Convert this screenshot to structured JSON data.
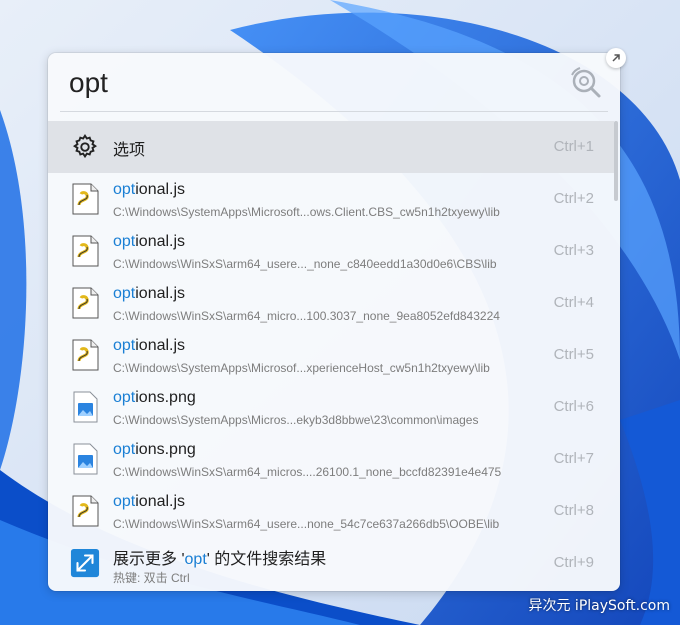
{
  "search": {
    "query": "opt"
  },
  "results": [
    {
      "icon": "gear-icon",
      "title_hl": "",
      "title_rest": "选项",
      "path": "",
      "shortcut": "Ctrl+1"
    },
    {
      "icon": "js-file-icon",
      "title_hl": "opt",
      "title_rest": "ional.js",
      "path": "C:\\Windows\\SystemApps\\Microsoft...ows.Client.CBS_cw5n1h2txyewy\\lib",
      "shortcut": "Ctrl+2"
    },
    {
      "icon": "js-file-icon",
      "title_hl": "opt",
      "title_rest": "ional.js",
      "path": "C:\\Windows\\WinSxS\\arm64_usere..._none_c840eedd1a30d0e6\\CBS\\lib",
      "shortcut": "Ctrl+3"
    },
    {
      "icon": "js-file-icon",
      "title_hl": "opt",
      "title_rest": "ional.js",
      "path": "C:\\Windows\\WinSxS\\arm64_micro...100.3037_none_9ea8052efd843224",
      "shortcut": "Ctrl+4"
    },
    {
      "icon": "js-file-icon",
      "title_hl": "opt",
      "title_rest": "ional.js",
      "path": "C:\\Windows\\SystemApps\\Microsof...xperienceHost_cw5n1h2txyewy\\lib",
      "shortcut": "Ctrl+5"
    },
    {
      "icon": "png-file-icon",
      "title_hl": "opt",
      "title_rest": "ions.png",
      "path": "C:\\Windows\\SystemApps\\Micros...ekyb3d8bbwe\\23\\common\\images",
      "shortcut": "Ctrl+6"
    },
    {
      "icon": "png-file-icon",
      "title_hl": "opt",
      "title_rest": "ions.png",
      "path": "C:\\Windows\\WinSxS\\arm64_micros....26100.1_none_bccfd82391e4e475",
      "shortcut": "Ctrl+7"
    },
    {
      "icon": "js-file-icon",
      "title_hl": "opt",
      "title_rest": "ional.js",
      "path": "C:\\Windows\\WinSxS\\arm64_usere...none_54c7ce637a266db5\\OOBE\\lib",
      "shortcut": "Ctrl+8"
    },
    {
      "icon": "expand-icon",
      "title_pre": "展示更多 '",
      "title_hl": "opt",
      "title_rest": "' 的文件搜索结果",
      "path": "热键: 双击 Ctrl",
      "shortcut": "Ctrl+9"
    }
  ],
  "watermark": "异次元 iPlaySoft.com",
  "colors": {
    "highlight": "#1a7fd4",
    "selected_row": "#dfe2e7",
    "wallpaper_blue": "#0a5fd8"
  }
}
